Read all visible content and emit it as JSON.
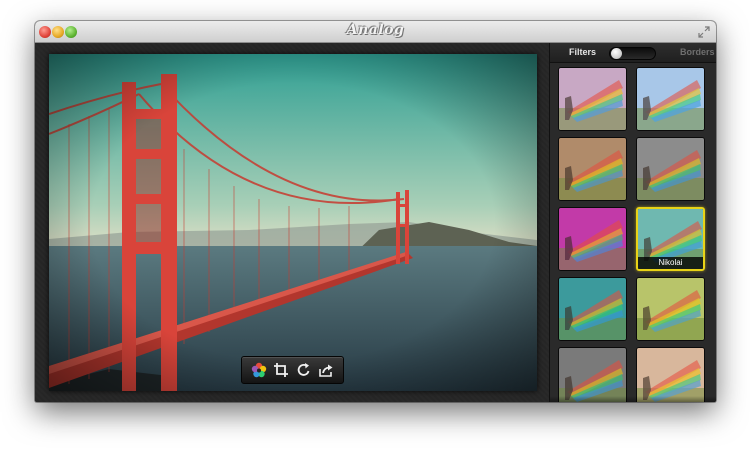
{
  "window": {
    "app_logo": "Analog"
  },
  "sidebar": {
    "tabs": [
      {
        "label": "Filters",
        "active": true
      },
      {
        "label": "Borders",
        "active": false
      }
    ],
    "filters": [
      {
        "label": "",
        "selected": false,
        "tint": "#c9a9c4"
      },
      {
        "label": "",
        "selected": false,
        "tint": "#a8c7e8"
      },
      {
        "label": "",
        "selected": false,
        "tint": "#b08b6a"
      },
      {
        "label": "",
        "selected": false,
        "tint": "#8c8c8c"
      },
      {
        "label": "",
        "selected": false,
        "tint": "#c23aa8"
      },
      {
        "label": "Nikolai",
        "selected": true,
        "tint": "#6fb9b0"
      },
      {
        "label": "",
        "selected": false,
        "tint": "#3d9a9c"
      },
      {
        "label": "",
        "selected": false,
        "tint": "#b8c46a"
      },
      {
        "label": "",
        "selected": false,
        "tint": "#7a7a7a"
      },
      {
        "label": "",
        "selected": false,
        "tint": "#d9b79c"
      }
    ]
  },
  "toolbar": {
    "buttons": [
      {
        "icon": "filters-color-wheel-icon"
      },
      {
        "icon": "crop-icon"
      },
      {
        "icon": "rotate-icon"
      },
      {
        "icon": "share-icon"
      }
    ]
  },
  "colors": {
    "selection_border": "#e8d317",
    "photo_sky": "#3aa59a",
    "bridge": "#d9443a"
  }
}
